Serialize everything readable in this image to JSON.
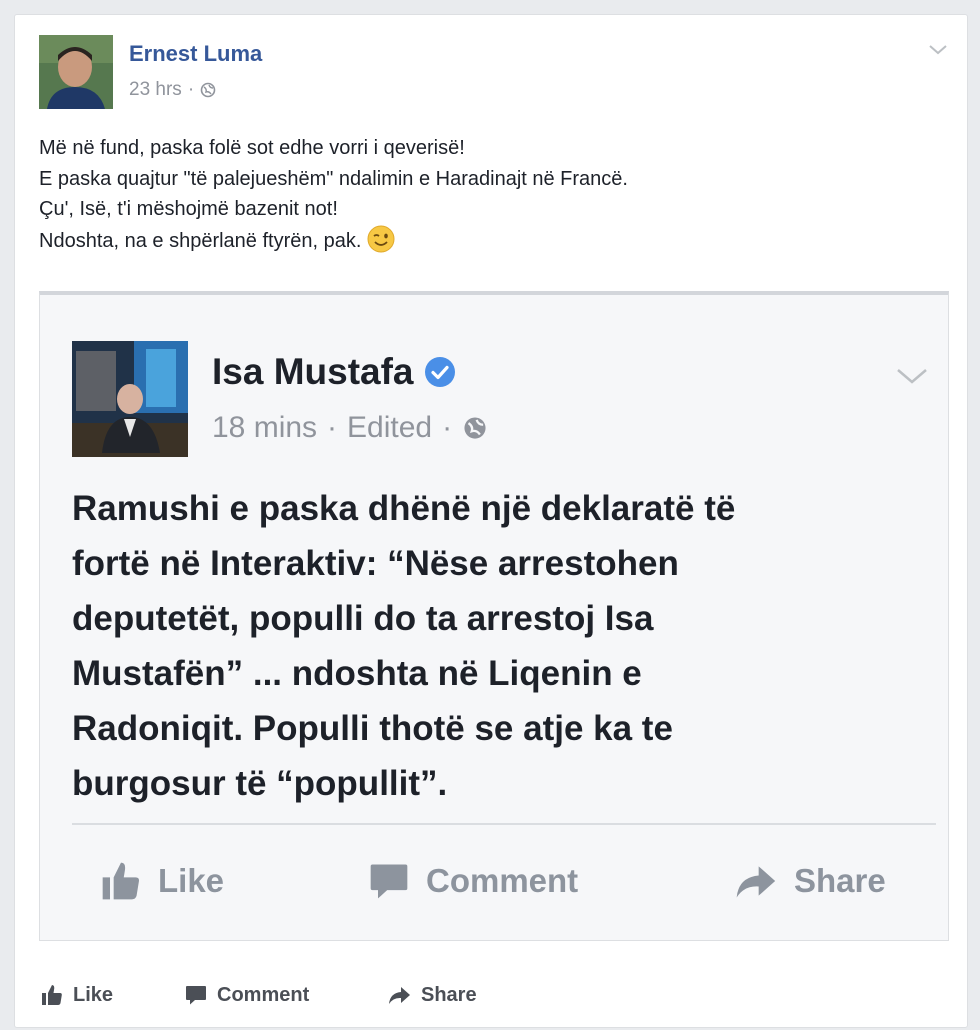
{
  "post": {
    "author": "Ernest Luma",
    "time": "23 hrs",
    "separator": "·",
    "lines": [
      "Më në fund, paska folë sot edhe vorri i qeverisë!",
      "E paska quajtur \"të palejueshëm\" ndalimin e Haradinajt në Francë.",
      "Çu', Isë, t'i mëshojmë bazenit not!",
      "Ndoshta, na e shpërlanë ftyrën, pak."
    ]
  },
  "shared": {
    "author": "Isa Mustafa",
    "time": "18 mins",
    "edited": "Edited",
    "separator": "·",
    "lines": [
      "Ramushi e paska dhënë një deklaratë të",
      "fortë në Interaktiv: “Nëse arrestohen",
      "deputetët, populli do ta arrestoj Isa",
      "Mustafën” ... ndoshta në Liqenin e",
      "Radoniqit. Populli thotë se atje ka te",
      "burgosur të “popullit”."
    ],
    "actions": {
      "like": "Like",
      "comment": "Comment",
      "share": "Share"
    }
  },
  "actions": {
    "like": "Like",
    "comment": "Comment",
    "share": "Share"
  },
  "colors": {
    "link": "#365899",
    "meta": "#90949c",
    "verified": "#4a8fe7",
    "action_gray": "#8d949e"
  },
  "icons": {
    "globe": "globe-icon",
    "verified": "verified-badge-icon",
    "like": "thumbs-up-icon",
    "comment": "comment-bubble-icon",
    "share": "share-arrow-icon",
    "menu": "chevron-down-icon",
    "emoji": "wink-emoji-icon"
  }
}
